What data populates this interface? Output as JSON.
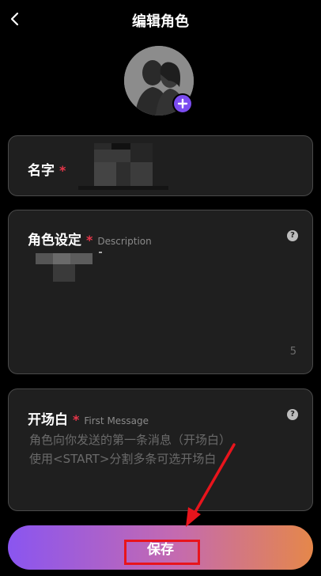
{
  "header": {
    "title": "编辑角色"
  },
  "name_field": {
    "label": "名字",
    "required_mark": "*"
  },
  "description_field": {
    "label": "角色设定",
    "required_mark": "*",
    "hint": "Description",
    "char_count": "5",
    "help_icon": "?"
  },
  "first_message_field": {
    "label": "开场白",
    "required_mark": "*",
    "hint": "First Message",
    "help_icon": "?",
    "placeholder": "角色向你发送的第一条消息（开场白）\n使用<START>分割多条可选开场白"
  },
  "save_button": {
    "label": "保存"
  },
  "colors": {
    "accent_purple": "#7b4cf0",
    "required_red": "#e8364a",
    "annotation_red": "#e8141c",
    "gradient_start": "#8a55f0",
    "gradient_end": "#e5874a"
  },
  "icons": {
    "back": "chevron-left-icon",
    "add_avatar": "plus-icon",
    "help": "question-circle-icon"
  }
}
